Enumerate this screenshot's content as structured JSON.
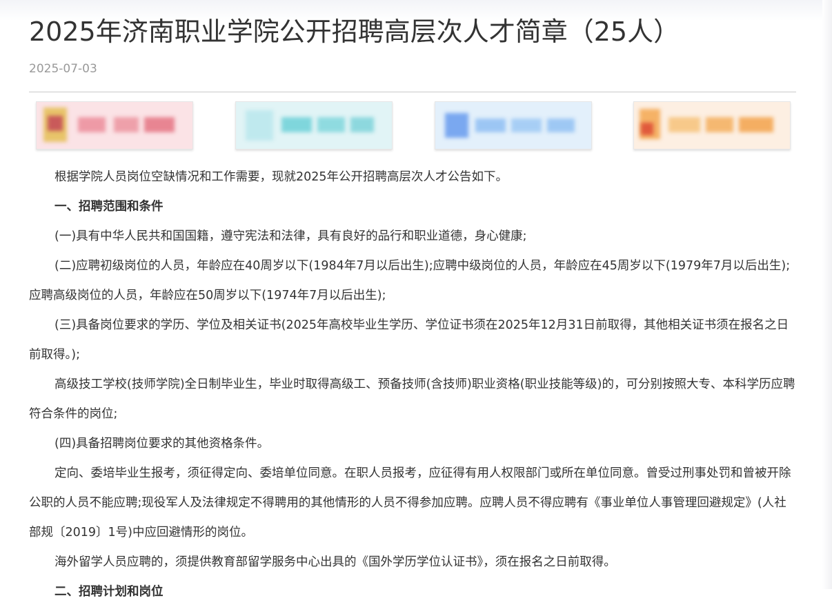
{
  "article": {
    "title": "2025年济南职业学院公开招聘高层次人才简章（25人）",
    "date": "2025-07-03",
    "banner_colors": [
      "#fbe3e6",
      "#e1f4f6",
      "#e3f0fb",
      "#fdefe2"
    ],
    "paragraphs": [
      "根据学院人员岗位空缺情况和工作需要，现就2025年公开招聘高层次人才公告如下。",
      "一、招聘范围和条件",
      "(一)具有中华人民共和国国籍，遵守宪法和法律，具有良好的品行和职业道德，身心健康;",
      "(二)应聘初级岗位的人员，年龄应在40周岁以下(1984年7月以后出生);应聘中级岗位的人员，年龄应在45周岁以下(1979年7月以后出生);应聘高级岗位的人员，年龄应在50周岁以下(1974年7月以后出生);",
      "(三)具备岗位要求的学历、学位及相关证书(2025年高校毕业生学历、学位证书须在2025年12月31日前取得，其他相关证书须在报名之日前取得。);",
      "高级技工学校(技师学院)全日制毕业生，毕业时取得高级工、预备技师(含技师)职业资格(职业技能等级)的，可分别按照大专、本科学历应聘符合条件的岗位;",
      "(四)具备招聘岗位要求的其他资格条件。",
      "定向、委培毕业生报考，须征得定向、委培单位同意。在职人员报考，应征得有用人权限部门或所在单位同意。曾受过刑事处罚和曾被开除公职的人员不能应聘;现役军人及法律规定不得聘用的其他情形的人员不得参加应聘。应聘人员不得应聘有《事业单位人事管理回避规定》(人社部规〔2019〕1号)中应回避情形的岗位。",
      "海外留学人员应聘的，须提供教育部留学服务中心出具的《国外学历学位认证书》，须在报名之日前取得。",
      "二、招聘计划和岗位"
    ]
  }
}
